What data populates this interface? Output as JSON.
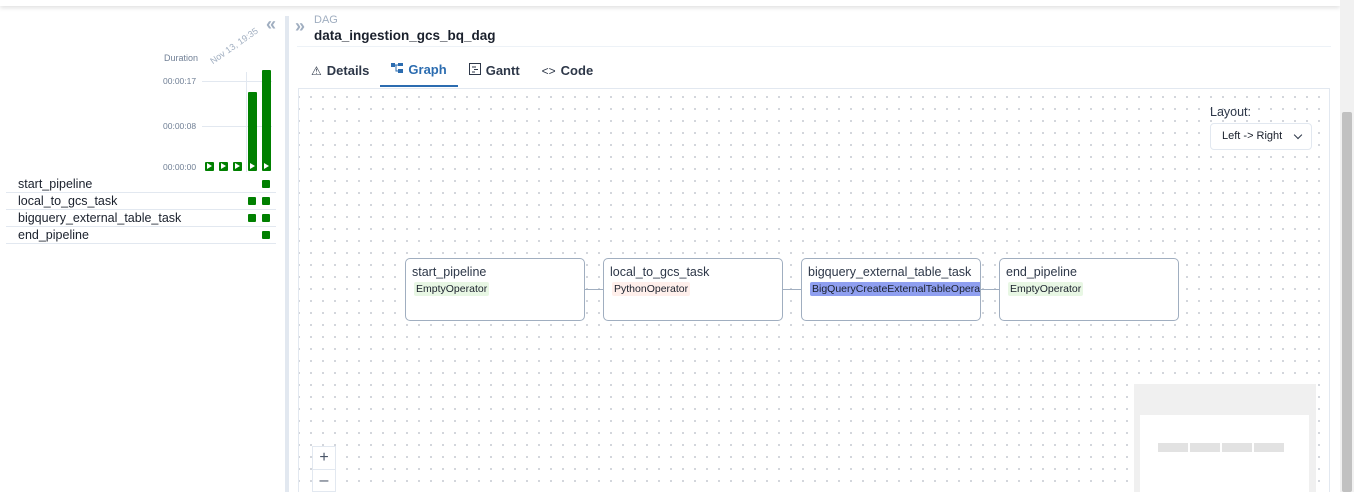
{
  "run_grid": {
    "collapse_icon": "double-chevron-left-icon",
    "duration_label": "Duration",
    "run_date": "Nov 13, 19:35",
    "ticks": [
      "00:00:17",
      "00:00:08",
      "00:00:00"
    ],
    "runs": [
      {
        "duration_seconds": 1,
        "state": "success"
      },
      {
        "duration_seconds": 1,
        "state": "success"
      },
      {
        "duration_seconds": 1,
        "state": "success"
      },
      {
        "duration_seconds": 15,
        "state": "success"
      },
      {
        "duration_seconds": 19,
        "state": "success"
      }
    ],
    "tasks": [
      {
        "name": "start_pipeline",
        "instances": 1
      },
      {
        "name": "local_to_gcs_task",
        "instances": 2
      },
      {
        "name": "bigquery_external_table_task",
        "instances": 2
      },
      {
        "name": "end_pipeline",
        "instances": 1
      }
    ],
    "success_color": "#008000"
  },
  "header": {
    "expand_icon": "double-chevron-right-icon",
    "kicker": "DAG",
    "title": "data_ingestion_gcs_bq_dag"
  },
  "tabs": [
    {
      "label": "Details",
      "icon": "warning-triangle-icon",
      "active": false
    },
    {
      "label": "Graph",
      "icon": "graph-icon",
      "active": true
    },
    {
      "label": "Gantt",
      "icon": "gantt-icon",
      "active": false
    },
    {
      "label": "Code",
      "icon": "code-icon",
      "active": false
    }
  ],
  "graph": {
    "layout_label": "Layout:",
    "layout_value": "Left -> Right",
    "nodes": [
      {
        "name": "start_pipeline",
        "operator": "EmptyOperator",
        "operator_color": "#e8f7e4"
      },
      {
        "name": "local_to_gcs_task",
        "operator": "PythonOperator",
        "operator_color": "#ffefeb"
      },
      {
        "name": "bigquery_external_table_task",
        "operator": "BigQueryCreateExternalTableOperator",
        "operator_color": "#8f9ff0"
      },
      {
        "name": "end_pipeline",
        "operator": "EmptyOperator",
        "operator_color": "#e8f7e4"
      }
    ],
    "zoom_in": "+",
    "zoom_out": "–"
  }
}
